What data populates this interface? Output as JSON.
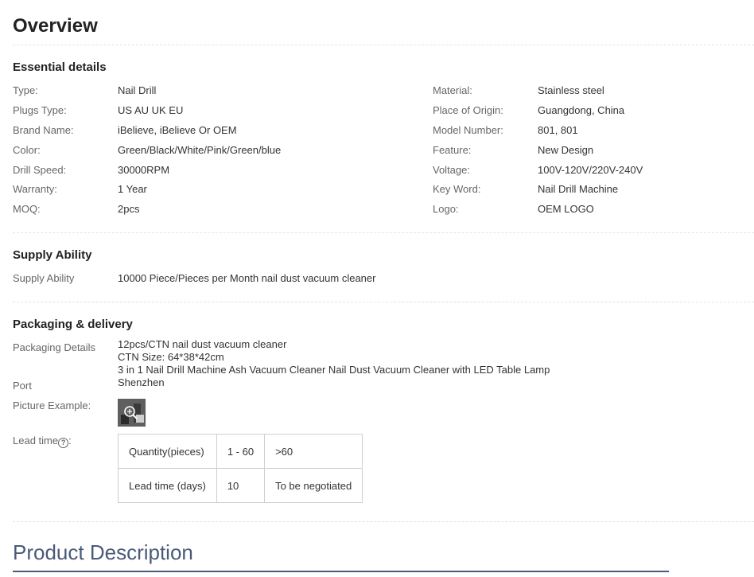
{
  "overview": {
    "title": "Overview"
  },
  "essential": {
    "title": "Essential details",
    "left": [
      {
        "label": "Type:",
        "value": "Nail Drill"
      },
      {
        "label": "Plugs Type:",
        "value": "US AU UK EU"
      },
      {
        "label": "Brand Name:",
        "value": "iBelieve, iBelieve Or OEM"
      },
      {
        "label": "Color:",
        "value": "Green/Black/White/Pink/Green/blue"
      },
      {
        "label": "Drill Speed:",
        "value": "30000RPM"
      },
      {
        "label": "Warranty:",
        "value": "1 Year"
      },
      {
        "label": "MOQ:",
        "value": "2pcs"
      }
    ],
    "right": [
      {
        "label": "Material:",
        "value": "Stainless steel"
      },
      {
        "label": "Place of Origin:",
        "value": "Guangdong, China"
      },
      {
        "label": "Model Number:",
        "value": "801, 801"
      },
      {
        "label": "Feature:",
        "value": "New Design"
      },
      {
        "label": "Voltage:",
        "value": "100V-120V/220V-240V"
      },
      {
        "label": "Key Word:",
        "value": "Nail Drill Machine"
      },
      {
        "label": "Logo:",
        "value": "OEM LOGO"
      }
    ]
  },
  "supply": {
    "title": "Supply Ability",
    "label": "Supply Ability",
    "value": "10000 Piece/Pieces per Month nail dust vacuum cleaner"
  },
  "packaging": {
    "title": "Packaging & delivery",
    "details_label": "Packaging Details",
    "details_lines": [
      "12pcs/CTN nail dust vacuum cleaner",
      "CTN Size: 64*38*42cm",
      "3 in 1 Nail Drill Machine Ash Vacuum Cleaner Nail Dust Vacuum Cleaner with LED Table Lamp"
    ],
    "port_label": "Port",
    "port_value": "Shenzhen",
    "picture_label": "Picture Example:",
    "lead_label": "Lead time",
    "lead_colon": ":",
    "help_glyph": "?",
    "lead_table": {
      "rows": [
        [
          "Quantity(pieces)",
          "1 - 60",
          ">60"
        ],
        [
          "Lead time (days)",
          "10",
          "To be negotiated"
        ]
      ]
    }
  },
  "product_description": {
    "title": "Product Description"
  },
  "colors": {
    "accent": "#4a5a78",
    "label": "#666666",
    "text": "#333333"
  }
}
